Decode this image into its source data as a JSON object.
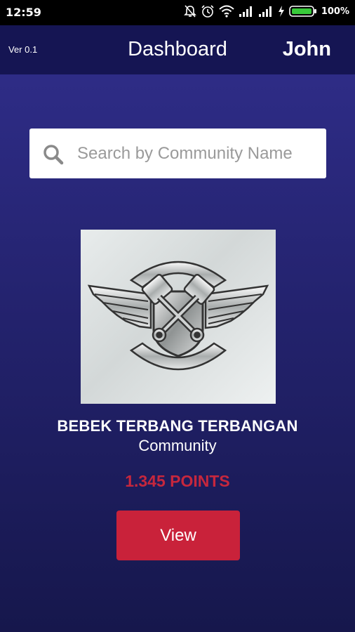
{
  "status_bar": {
    "time": "12:59",
    "battery_percent": "100%",
    "icons": [
      "mute-icon",
      "alarm-icon",
      "wifi-icon",
      "signal-icon",
      "signal-icon",
      "charging-icon",
      "battery-icon"
    ]
  },
  "app_bar": {
    "version": "Ver 0.1",
    "title": "Dashboard",
    "user_name": "John"
  },
  "search": {
    "placeholder": "Search by Community Name",
    "value": ""
  },
  "community": {
    "name": "BEBEK TERBANG TERBANGAN",
    "type": "Community",
    "points": "1.345 POINTS",
    "view_label": "View"
  },
  "colors": {
    "background": "#24236f",
    "app_bar": "#151553",
    "accent_red": "#c9223a",
    "points_text": "#c6273d"
  }
}
